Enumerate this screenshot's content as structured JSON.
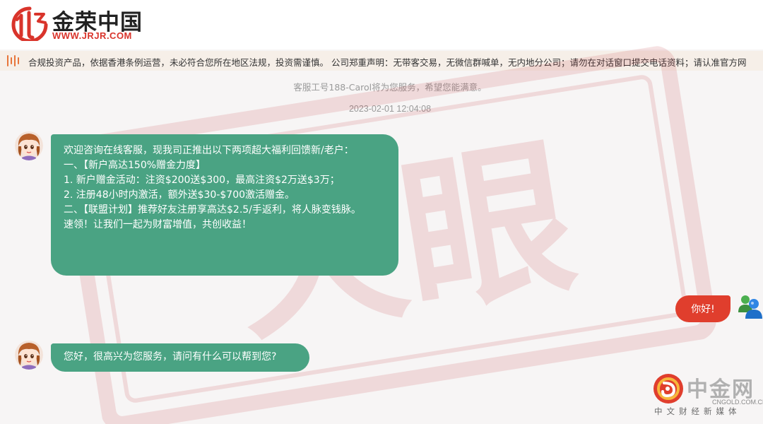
{
  "header": {
    "logo_name": "金荣中国",
    "logo_url": "WWW.JRJR.COM"
  },
  "notice": {
    "text": "合规投资产品，依据香港条例运营，未必符合您所在地区法规，投资需谨慎。 公司郑重声明：无带客交易，无微信群喊单，无内地分公司；请勿在对话窗口提交电话资料；请认准官方网"
  },
  "chat": {
    "service_info": "客服工号188-Carol将为您服务，希望您能满意。",
    "timestamp": "2023-02-01 12:04:08",
    "messages": [
      {
        "sender": "agent",
        "lines": [
          "欢迎咨询在线客服，现我司正推出以下两项超大福利回馈新/老户：",
          "",
          "一、【新户高达150%赠金力度】",
          "1. 新户赠金活动：注资$200送$300，最高注资$2万送$3万；",
          "2. 注册48小时内激活，额外送$30-$700激活赠金。",
          "",
          "二、【联盟计划】推荐好友注册享高达$2.5/手返利，将人脉变钱脉。",
          "",
          "速领！让我们一起为财富增值，共创收益！"
        ]
      },
      {
        "sender": "user",
        "text": "你好!"
      },
      {
        "sender": "agent",
        "text": "您好，很高兴为您服务，请问有什么可以帮到您?"
      }
    ]
  },
  "watermark": {
    "text": "天眼",
    "color": "#c0282d"
  },
  "footer": {
    "brand": "中金网",
    "url": "CNGOLD.COM.CN",
    "slogan": "中文财经新媒体"
  },
  "colors": {
    "agent_bubble": "#4aa383",
    "user_bubble": "#e03e2d",
    "brand_red": "#d9342b",
    "notice_bg": "#f6efe8"
  }
}
